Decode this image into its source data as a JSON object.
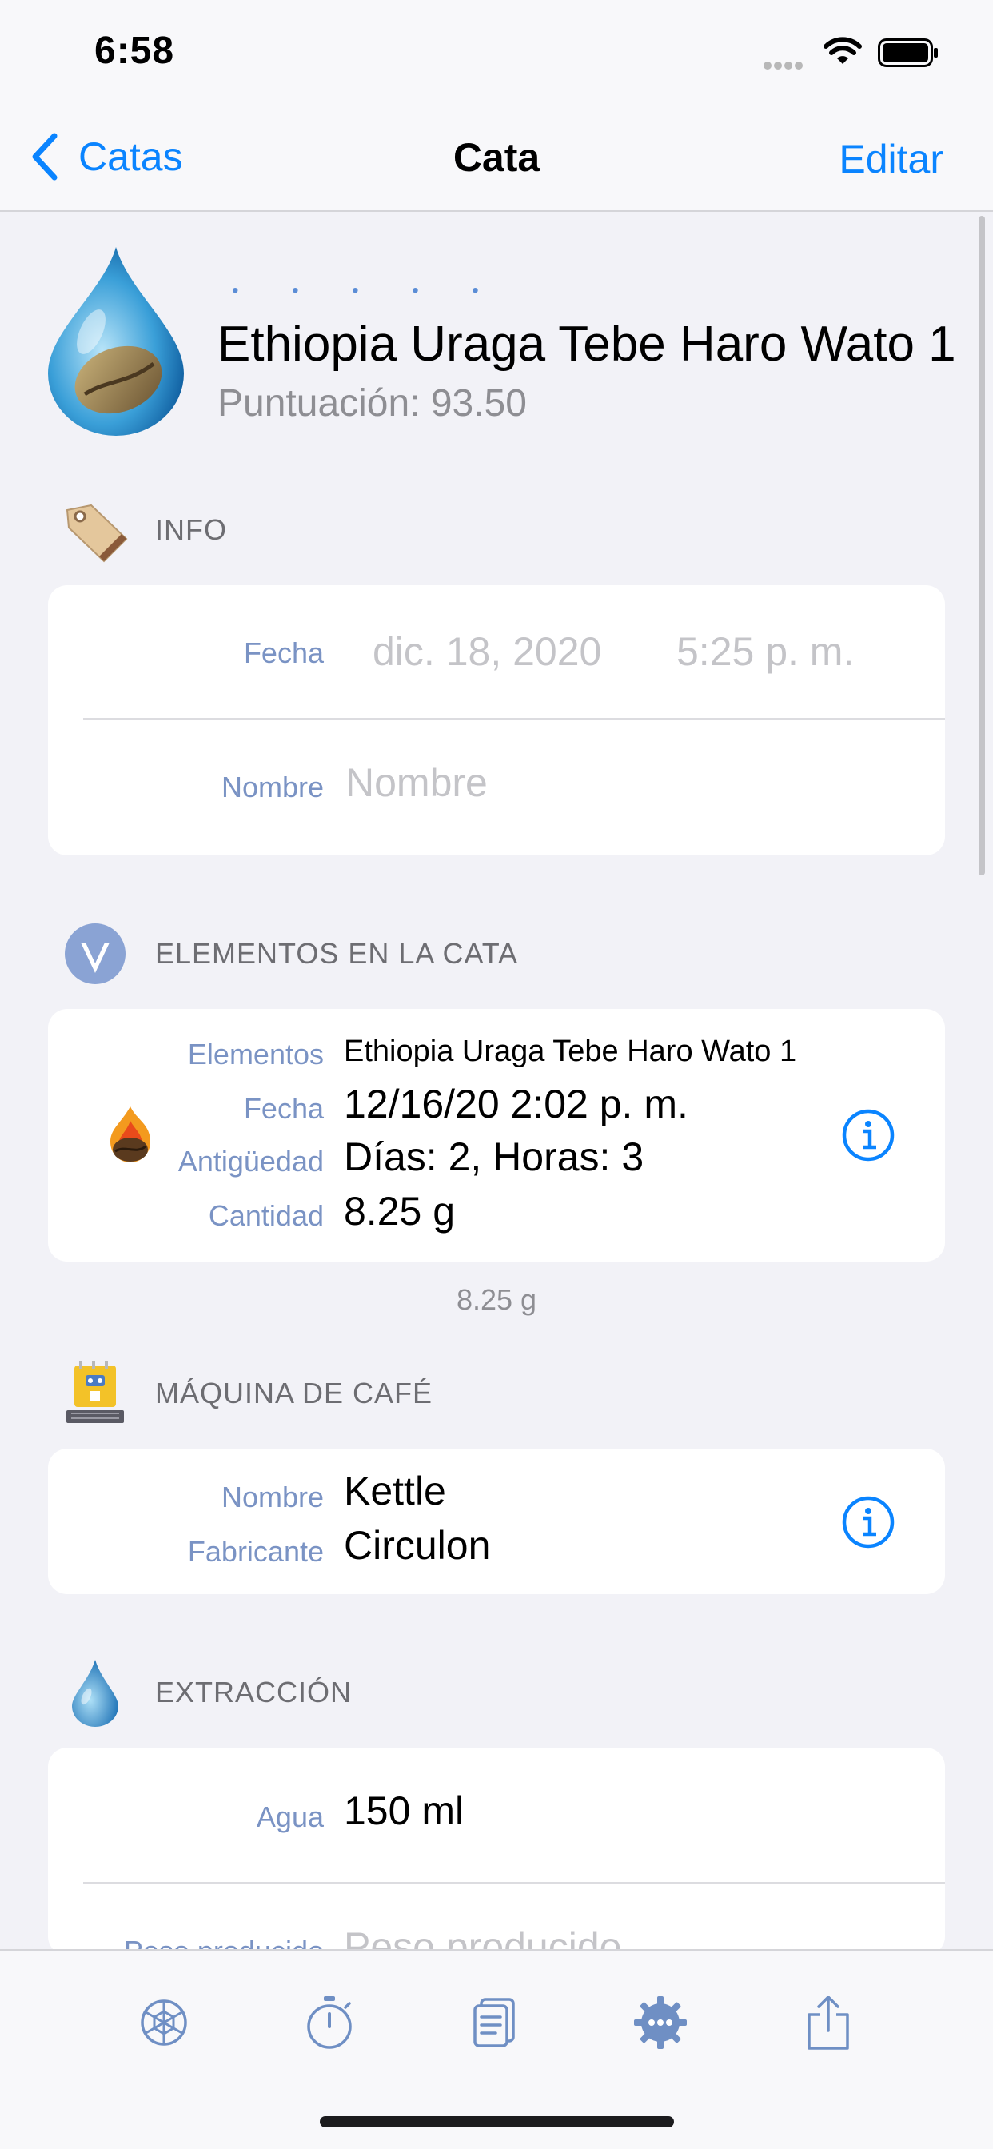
{
  "status": {
    "time": "6:58"
  },
  "nav": {
    "back_label": "Catas",
    "title": "Cata",
    "edit_label": "Editar"
  },
  "header": {
    "rating_dots": "• • • • •",
    "coffee_name": "Ethiopia Uraga Tebe Haro Wato 1",
    "score": "Puntuación: 93.50"
  },
  "info": {
    "section_title": "INFO",
    "date_label": "Fecha",
    "date_value": "dic. 18, 2020",
    "time_value": "5:25 p. m.",
    "name_label": "Nombre",
    "name_placeholder": "Nombre"
  },
  "elements": {
    "section_title": "ELEMENTOS EN LA CATA",
    "rows": [
      {
        "label": "Elementos",
        "value": "Ethiopia Uraga Tebe Haro Wato 1"
      },
      {
        "label": "Fecha",
        "value": "12/16/20 2:02 p. m."
      },
      {
        "label": "Antigüedad",
        "value": "Días: 2, Horas: 3"
      },
      {
        "label": "Cantidad",
        "value": "8.25 g"
      }
    ],
    "footnote": "8.25 g"
  },
  "machine": {
    "section_title": "MÁQUINA DE CAFÉ",
    "name_label": "Nombre",
    "name_value": "Kettle",
    "maker_label": "Fabricante",
    "maker_value": "Circulon"
  },
  "extraction": {
    "section_title": "EXTRACCIÓN",
    "water_label": "Agua",
    "water_value": "150 ml",
    "yield_label": "Peso producido",
    "yield_placeholder": "Peso producido"
  },
  "tabs": [
    "aroma-wheel-icon",
    "stopwatch-icon",
    "notes-icon",
    "settings-icon",
    "share-icon"
  ],
  "colors": {
    "accent": "#0a84ff",
    "label": "#7a93c4",
    "secondary": "#8e8e93"
  }
}
